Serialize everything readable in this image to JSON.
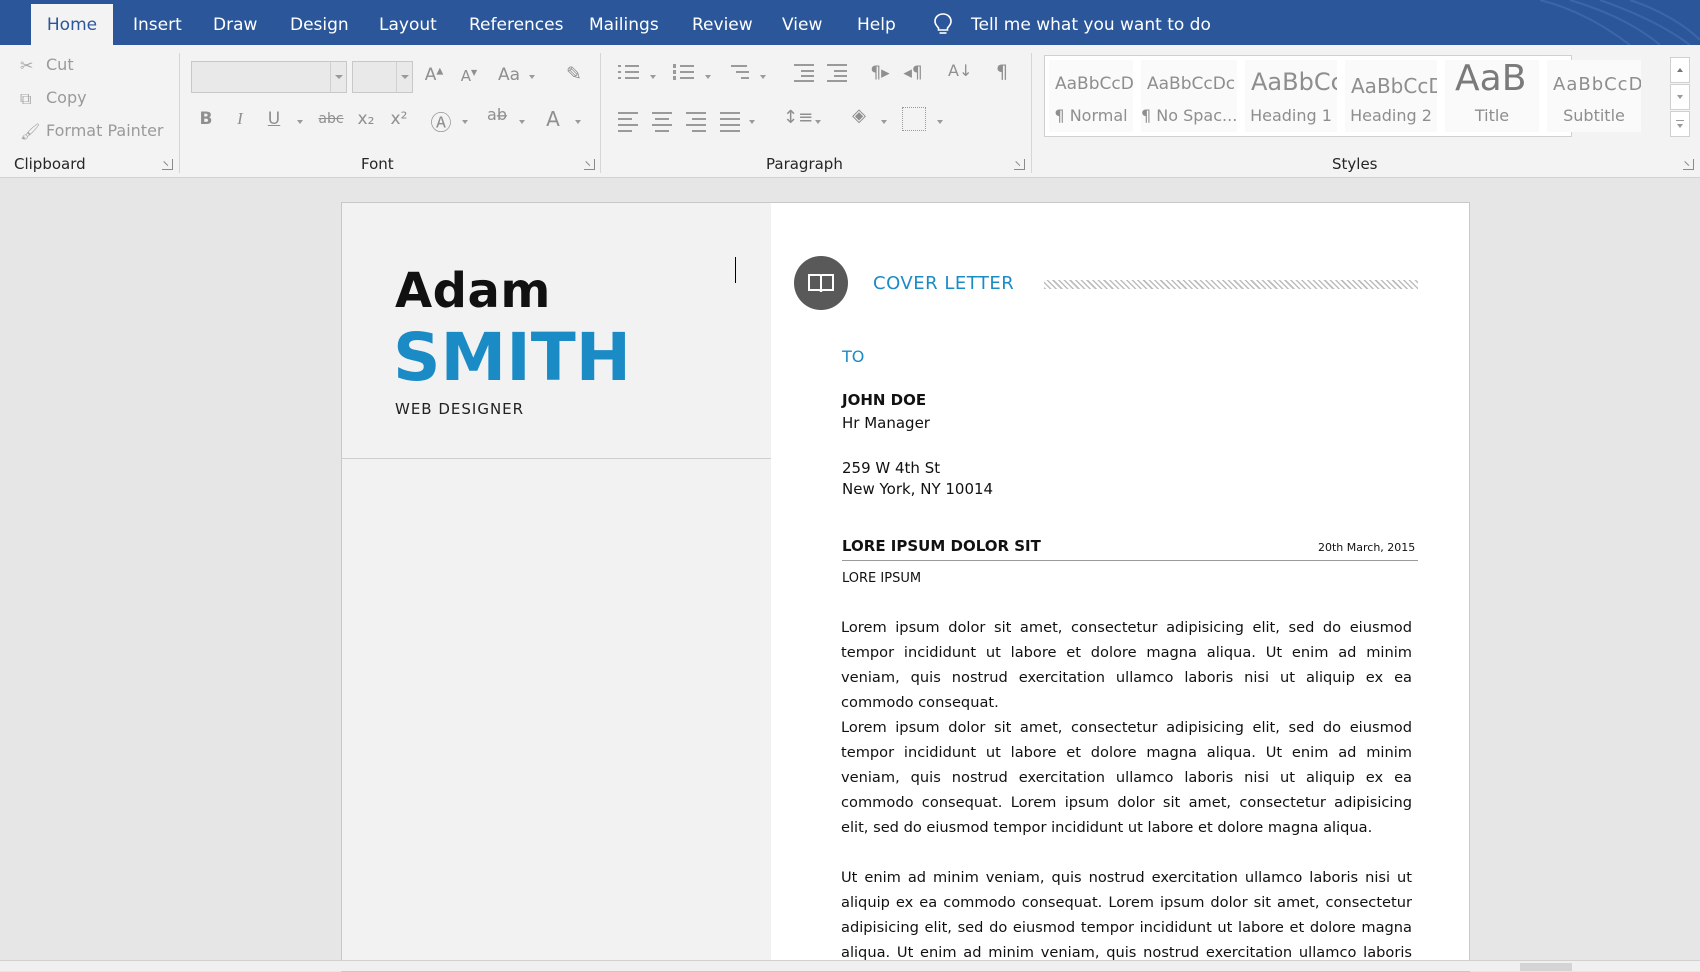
{
  "ribbon_tabs": {
    "home": "Home",
    "insert": "Insert",
    "draw": "Draw",
    "design": "Design",
    "layout": "Layout",
    "references": "References",
    "mailings": "Mailings",
    "review": "Review",
    "view": "View",
    "help": "Help"
  },
  "tell_me": "Tell me what you want to do",
  "clipboard": {
    "cut": "Cut",
    "copy": "Copy",
    "format_painter": "Format Painter",
    "label": "Clipboard"
  },
  "font": {
    "label": "Font",
    "change_case": "Aa",
    "bold": "B",
    "italic": "I",
    "underline": "U",
    "strikethrough": "abc",
    "subscript": "x₂",
    "superscript": "x²",
    "font_color": "A"
  },
  "paragraph": {
    "label": "Paragraph"
  },
  "styles": {
    "label": "Styles",
    "items": [
      {
        "preview": "AaBbCcDc",
        "name": "¶ Normal"
      },
      {
        "preview": "AaBbCcDc",
        "name": "¶ No Spac..."
      },
      {
        "preview": "AaBbCc",
        "name": "Heading 1"
      },
      {
        "preview": "AaBbCcD",
        "name": "Heading 2"
      },
      {
        "preview": "AaB",
        "name": "Title"
      },
      {
        "preview": "AaBbCcD",
        "name": "Subtitle"
      }
    ]
  },
  "document": {
    "first_name": "Adam",
    "last_name": "SMITH",
    "role": "WEB DESIGNER",
    "section_title": "COVER LETTER",
    "to_label": "TO",
    "recipient_name": "JOHN DOE",
    "recipient_title": "Hr Manager",
    "address_line1": "259 W 4th St",
    "address_line2": "New York, NY 10014",
    "subject": "LORE IPSUM DOLOR SIT",
    "date": "20th March, 2015",
    "subheading": "LORE IPSUM",
    "paragraph1": "Lorem ipsum dolor sit amet, consectetur adipisicing elit, sed do eiusmod tempor incididunt ut labore et dolore magna aliqua. Ut enim ad minim veniam, quis nostrud exercitation ullamco laboris nisi ut aliquip ex ea commodo consequat.",
    "paragraph2": "Lorem ipsum dolor sit amet, consectetur adipisicing elit, sed do eiusmod tempor incididunt ut labore et dolore magna aliqua. Ut enim ad minim veniam, quis nostrud exercitation ullamco laboris nisi ut aliquip ex ea commodo consequat. Lorem ipsum dolor sit amet, consectetur adipisicing elit, sed do eiusmod tempor incididunt ut labore et dolore magna aliqua.",
    "paragraph3": "Ut enim ad minim veniam, quis nostrud exercitation ullamco laboris nisi ut aliquip ex ea commodo consequat. Lorem ipsum dolor sit amet, consectetur adipisicing elit, sed do eiusmod tempor incididunt ut labore et dolore magna aliqua. Ut enim ad minim veniam, quis nostrud exercitation ullamco laboris nisi"
  },
  "colors": {
    "ribbon_blue": "#2b579a",
    "accent_blue": "#1b8bc6",
    "left_panel": "#f2f2f2",
    "icon_circle": "#595959"
  },
  "icons": [
    "lightbulb-icon",
    "cut-icon",
    "copy-icon",
    "format-painter-icon",
    "book-icon"
  ]
}
